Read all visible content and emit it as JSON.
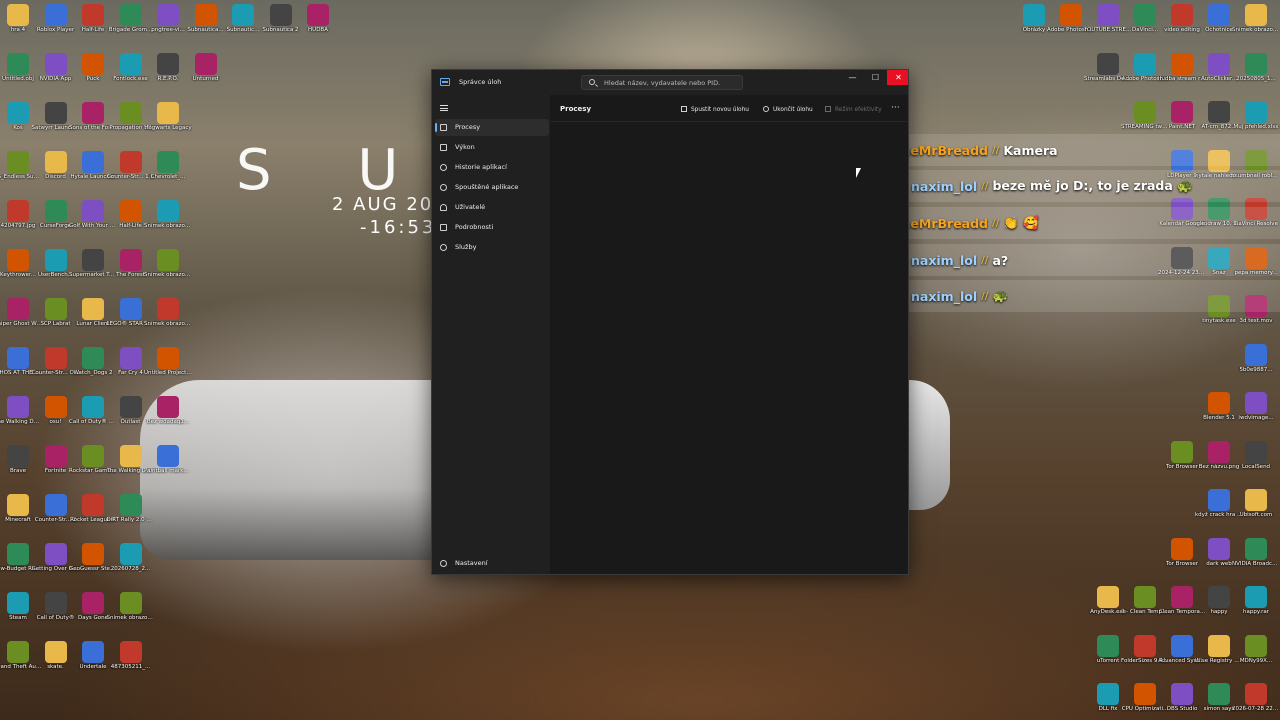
{
  "wallpaper": {
    "headline": "S U N D",
    "date": "2 AUG 20",
    "time": "-16:53-"
  },
  "desktop_icons_left": [
    [
      "hra 4",
      "Roblox Player",
      "Half-Life",
      "Brigade Grom...",
      "pngtree-vi...",
      "Subnautica...",
      "Subnautic...",
      "Subnautica 2",
      "HUDBA"
    ],
    [
      "Untitled.obj",
      "NVIDIA App",
      "Puck",
      "Fontlock.exe",
      "R.E.P.O.",
      "Unturned"
    ],
    [
      "Koš",
      "Satwyrr Launcher",
      "Sons of the Forest",
      "Propagation VR",
      "Hogwarts Legacy"
    ],
    [
      "ES_Endless Summer...",
      "Discord",
      "Hytale Launcher",
      "Counter-Str... 1.6",
      "Chevrolet_..."
    ],
    [
      "4204797.jpg",
      "CurseForge",
      "Golf With Your Friends",
      "Half-Life",
      "Snímek obrazovk..."
    ],
    [
      "Keythrower...",
      "UserBench...",
      "Supermarket Together",
      "The Forest",
      "Snímek obrazovk..."
    ],
    [
      "Sniper Ghost Warrior 2",
      "SCP Labrat",
      "Lunar Client",
      "LEGO® STAR WARS™ Th...",
      "Snímek obrazovk..."
    ],
    [
      "WHOS AT THE DOOR",
      "Counter-Str... Offensive",
      "Watch_Dogs 2",
      "Far Cry 4",
      "Untitled Project 33"
    ],
    [
      "The Walking Dead Saint...",
      "osu!",
      "Call of Duty® M...",
      "Outlast",
      "Bez wdadaq1..."
    ],
    [
      "Brave",
      "Fortnite",
      "Rockstar Games...",
      "The Walking Dead - Sea...",
      "Paintball marker..."
    ],
    [
      "Minecraft",
      "Counter-Str... 2",
      "Rocket League®",
      "DiRT Rally 2.0 Game of th..."
    ],
    [
      "Low-Budget Repairs Pl...",
      "Getting Over It with Ben...",
      "GeoGuessr Steam E...",
      "20260728_2..."
    ],
    [
      "Steam",
      "Call of Duty®",
      "Days Gone",
      "Snímek obrazovk..."
    ],
    [
      "Grand Theft Auto V Le...",
      "skate.",
      "Undertale",
      "487305211_..."
    ]
  ],
  "desktop_icons_right": [
    [
      "Snímek obrazovk...",
      "Ochotnice",
      "video editing",
      "DaVinci...",
      "YOUTUBE STREAMING",
      "Adobe Photosho...",
      "Obrázky"
    ],
    [
      "20250805_1...",
      "AutoClicker...",
      "hudba stream ren...",
      "Adobe Photosh...",
      "Streamlabs Desktop"
    ],
    [
      "Muj přehled.xlsx",
      "AT-cm_872...",
      "Paint.NET",
      "STREAMING twitch old"
    ],
    [
      "thumbnail roblox.png",
      "hytale nahledovka...",
      "LDPlayer 9"
    ],
    [
      "DaVinci Resolve",
      "autodraw 10. 9. 2025 17...",
      "Kalendář Google"
    ],
    [
      "pepa memory...",
      "Snaz",
      "2024-12-24 23-50-22..."
    ],
    [
      "3d test.mov",
      "tinytask.exe"
    ],
    [
      "5b0e9887..."
    ],
    [
      "iwdvimage...",
      "Blender 5.1"
    ],
    [
      "LocalSend",
      "Bez názvu.png",
      "Tor Browser"
    ],
    [
      "Ubisoft.com",
      "když crack hra chce..."
    ],
    [
      "NVIDIA Broadcast",
      "dark web",
      "Tor Browser"
    ],
    [
      "happy.rar",
      "happy",
      "Clean Tempora...",
      "7 - Clean Tempora...",
      "AnyDesk.exe"
    ],
    [
      "MDNy99X...",
      "Wise Registry Cleaner",
      "Advanced SystemCare",
      "FolderSizes 9 Run as Ad...",
      "uTorrent"
    ],
    [
      "2026-07-28 22-01-22...",
      "simon says",
      "OBS Studio",
      "CPU Optimizati...",
      "DLL fix"
    ]
  ],
  "chat": [
    {
      "name": "TheMrBreadd",
      "badge": false,
      "message": "Kamera"
    },
    {
      "name": "naxim_lol",
      "badge": true,
      "message": "beze mě jo D:, to je zrada 🐢"
    },
    {
      "name": "TheMrBreadd",
      "badge": false,
      "message": "👏 🥰"
    },
    {
      "name": "naxim_lol",
      "badge": true,
      "message": "a?"
    },
    {
      "name": "naxim_lol",
      "badge": true,
      "message": "🐢"
    }
  ],
  "taskmanager": {
    "title": "Správce úloh",
    "search_placeholder": "Hledat název, vydavatele nebo PID.",
    "window_controls": {
      "minimize": "—",
      "maximize": "☐",
      "close": "✕"
    },
    "nav": [
      {
        "label": "Procesy",
        "icon": "processes-icon",
        "active": true
      },
      {
        "label": "Výkon",
        "icon": "performance-icon",
        "active": false
      },
      {
        "label": "Historie aplikací",
        "icon": "app-history-icon",
        "active": false
      },
      {
        "label": "Spouštěné aplikace",
        "icon": "startup-apps-icon",
        "active": false
      },
      {
        "label": "Uživatelé",
        "icon": "users-icon",
        "active": false
      },
      {
        "label": "Podrobnosti",
        "icon": "details-icon",
        "active": false
      },
      {
        "label": "Služby",
        "icon": "services-icon",
        "active": false
      }
    ],
    "settings_label": "Nastavení",
    "page_title": "Procesy",
    "toolbar": {
      "new_task": "Spustit novou úlohu",
      "end_task": "Ukončit úlohu",
      "efficiency": "Režim efektivity",
      "more": "···"
    }
  },
  "colors": {
    "accent": "#6aaff0",
    "close_button": "#e81123",
    "chat_name_orange": "#f6a21e",
    "chat_name_blue": "#9fd1ff",
    "window_bg": "#1c1c1c"
  }
}
